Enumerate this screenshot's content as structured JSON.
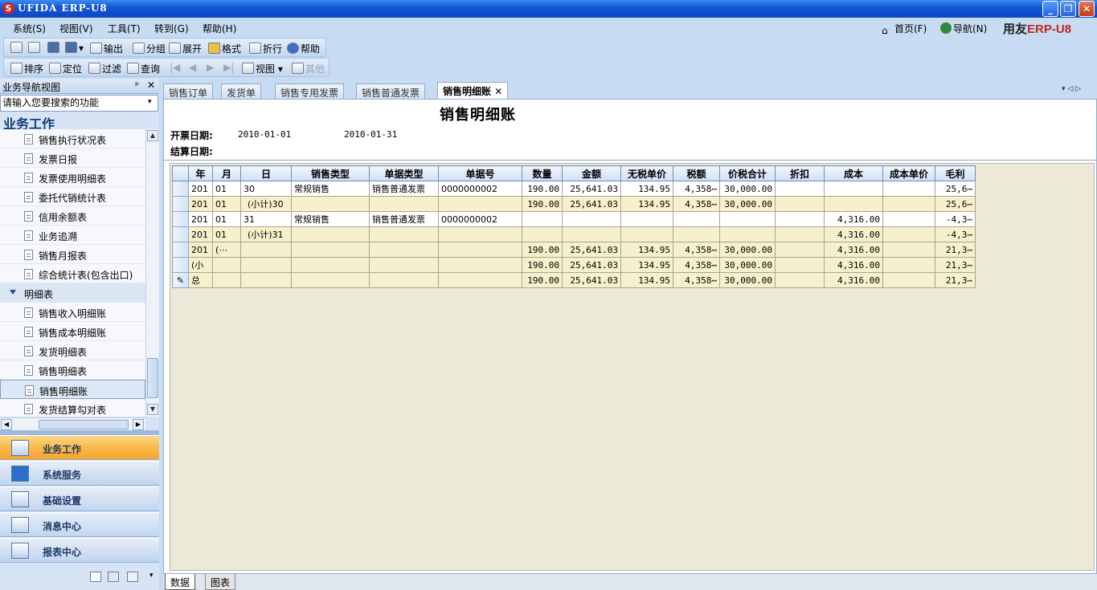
{
  "window": {
    "title": "UFIDA ERP-U8"
  },
  "menu": [
    "系统(S)",
    "视图(V)",
    "工具(T)",
    "转到(G)",
    "帮助(H)"
  ],
  "right_links": {
    "home": "首页(F)",
    "nav": "导航(N)"
  },
  "brand": {
    "a": "用友",
    "b": "ERP-U8"
  },
  "toolbar1": [
    "输出",
    "分组",
    "展开",
    "格式",
    "折行",
    "帮助"
  ],
  "toolbar2": [
    "排序",
    "定位",
    "过滤",
    "查询",
    "视图",
    "其他"
  ],
  "nav": {
    "header": "业务导航视图",
    "search_placeholder": "请输入您要搜索的功能",
    "title": "业务工作",
    "items": [
      "销售执行状况表",
      "发票日报",
      "发票使用明细表",
      "委托代销统计表",
      "信用余额表",
      "业务追溯",
      "销售月报表",
      "综合统计表(包含出口)"
    ],
    "group": "明细表",
    "group_items": [
      "销售收入明细账",
      "销售成本明细账",
      "发货明细表",
      "销售明细表",
      "销售明细账",
      "发货结算勾对表"
    ],
    "buttons": [
      "业务工作",
      "系统服务",
      "基础设置",
      "消息中心",
      "报表中心"
    ]
  },
  "tabs": [
    "销售订单",
    "发货单",
    "销售专用发票",
    "销售普通发票",
    "销售明细账"
  ],
  "report": {
    "title": "销售明细账",
    "invoice_date_label": "开票日期:",
    "date_from": "2010-01-01",
    "date_to": "2010-01-31",
    "settle_date_label": "结算日期:",
    "columns": [
      "年",
      "月",
      "日",
      "销售类型",
      "单据类型",
      "单据号",
      "数量",
      "金额",
      "无税单价",
      "税额",
      "价税合计",
      "折扣",
      "成本",
      "成本单价",
      "毛利"
    ],
    "rows": [
      [
        "201",
        "01",
        "30",
        "常规销售",
        "销售普通发票",
        "0000000002",
        "190.00",
        "25,641.03",
        "134.95",
        "4,358⋯",
        "30,000.00",
        "",
        "",
        "",
        "25,6⋯"
      ],
      [
        "201",
        "01",
        "(小计)30",
        "",
        "",
        "",
        "190.00",
        "25,641.03",
        "134.95",
        "4,358⋯",
        "30,000.00",
        "",
        "",
        "",
        "25,6⋯"
      ],
      [
        "201",
        "01",
        "31",
        "常规销售",
        "销售普通发票",
        "0000000002",
        "",
        "",
        "",
        "",
        "",
        "",
        "4,316.00",
        "",
        "-4,3⋯"
      ],
      [
        "201",
        "01",
        "(小计)31",
        "",
        "",
        "",
        "",
        "",
        "",
        "",
        "",
        "",
        "4,316.00",
        "",
        "-4,3⋯"
      ],
      [
        "201",
        "(⋯",
        "",
        "",
        "",
        "",
        "190.00",
        "25,641.03",
        "134.95",
        "4,358⋯",
        "30,000.00",
        "",
        "4,316.00",
        "",
        "21,3⋯"
      ],
      [
        "(小",
        "",
        "",
        "",
        "",
        "",
        "190.00",
        "25,641.03",
        "134.95",
        "4,358⋯",
        "30,000.00",
        "",
        "4,316.00",
        "",
        "21,3⋯"
      ],
      [
        "总",
        "",
        "",
        "",
        "",
        "",
        "190.00",
        "25,641.03",
        "134.95",
        "4,358⋯",
        "30,000.00",
        "",
        "4,316.00",
        "",
        "21,3⋯"
      ]
    ]
  },
  "bottom_tabs": [
    "数据",
    "图表"
  ]
}
